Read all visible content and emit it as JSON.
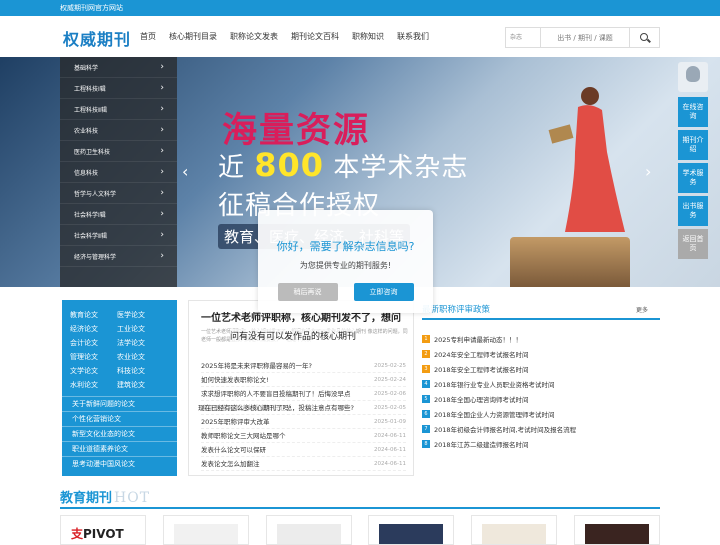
{
  "topbar": {
    "text": "权威期刊网官方网站"
  },
  "logo": "权威期刊",
  "nav": [
    "首页",
    "核心期刊目录",
    "职称论文发表",
    "期刊论文百科",
    "职称知识",
    "联系我们"
  ],
  "search": {
    "select": "杂志",
    "placeholder": "出书 / 期刊 / 课题"
  },
  "banner": {
    "categories": [
      "基础科学",
      "工程科技Ⅰ辑",
      "工程科技Ⅱ辑",
      "农业科技",
      "医药卫生科技",
      "信息科技",
      "哲学与人文科学",
      "社会科学Ⅰ辑",
      "社会科学Ⅱ辑",
      "经济与管理科学"
    ],
    "headline": "海量资源",
    "line2_pre": "近 ",
    "line2_num": "800",
    "line2_post": " 本学术杂志",
    "line3": "征稿合作授权",
    "line4": "教育、医疗、经济、社科等"
  },
  "sidebar": {
    "buttons": [
      "在线咨询",
      "期刊介绍",
      "学术服务",
      "出书服务",
      "返回首页"
    ]
  },
  "modal": {
    "title": "你好，需要了解杂志信息吗?",
    "subtitle": "为您提供专业的期刊服务!",
    "later": "稍后再说",
    "consult": "立即咨询"
  },
  "cats": {
    "grid": [
      "教育论文",
      "医学论文",
      "经济论文",
      "工业论文",
      "会计论文",
      "法学论文",
      "管理论文",
      "农业论文",
      "文学论文",
      "科技论文",
      "水利论文",
      "建筑论文"
    ],
    "list": [
      "关于新鲜问题的论文",
      "个性化营销论文",
      "新型文化业态的论文",
      "职业道德素养论文",
      "思考动漫中国风论文"
    ]
  },
  "articles": {
    "title": "一位艺术老师评职称，核心期刊发不了，想问",
    "desc": "一位艺术老师评职称，核心期刊发不了，想问有没有可以发作品的核心期刊 像这样的问题，同老师一般都是直接问周老公需要投，一老是中文核",
    "overlay": "问有没有可以发作品的核心期刊",
    "overlay2": "现在已经有这么多核心期刊了吗",
    "rows": [
      {
        "t": "2025年将是未来评职称最容易的一年?",
        "d": "2025-02-25"
      },
      {
        "t": "如何快速发表职称论文!",
        "d": "2025-02-24"
      },
      {
        "t": "求求想评职称的人不要盲目投稿期刊了！后悔没早点",
        "d": "2025-02-06"
      },
      {
        "t": "高级职称评审论文发表知识汇总，投稿注意点有哪些?",
        "d": "2025-02-05"
      },
      {
        "t": "2025年职称评审大改革",
        "d": "2025-01-09"
      },
      {
        "t": "教师职称论文三大网站是哪个",
        "d": "2024-06-11"
      },
      {
        "t": "发表什么论文可以保研",
        "d": "2024-06-11"
      },
      {
        "t": "发表论文怎么加翻注",
        "d": "2024-06-11"
      }
    ]
  },
  "policy": {
    "title": "最新职称评审政策",
    "more": "更多",
    "rows": [
      "2025专利申请最新动态！！！",
      "2024年安全工程师考试报名时间",
      "2018年安全工程师考试报名时间",
      "2018年银行业专业人员职业资格考试时间",
      "2018年全国心理咨询师考试时间",
      "2018年全国企业人力资源管理师考试时间",
      "2018年初级会计师报名时间,考试时间及报名流程",
      "2018年江苏二级建造师报名时间"
    ]
  },
  "edu": {
    "title": "教育期刊",
    "en": "HOT",
    "cover1": "PIVOT"
  }
}
